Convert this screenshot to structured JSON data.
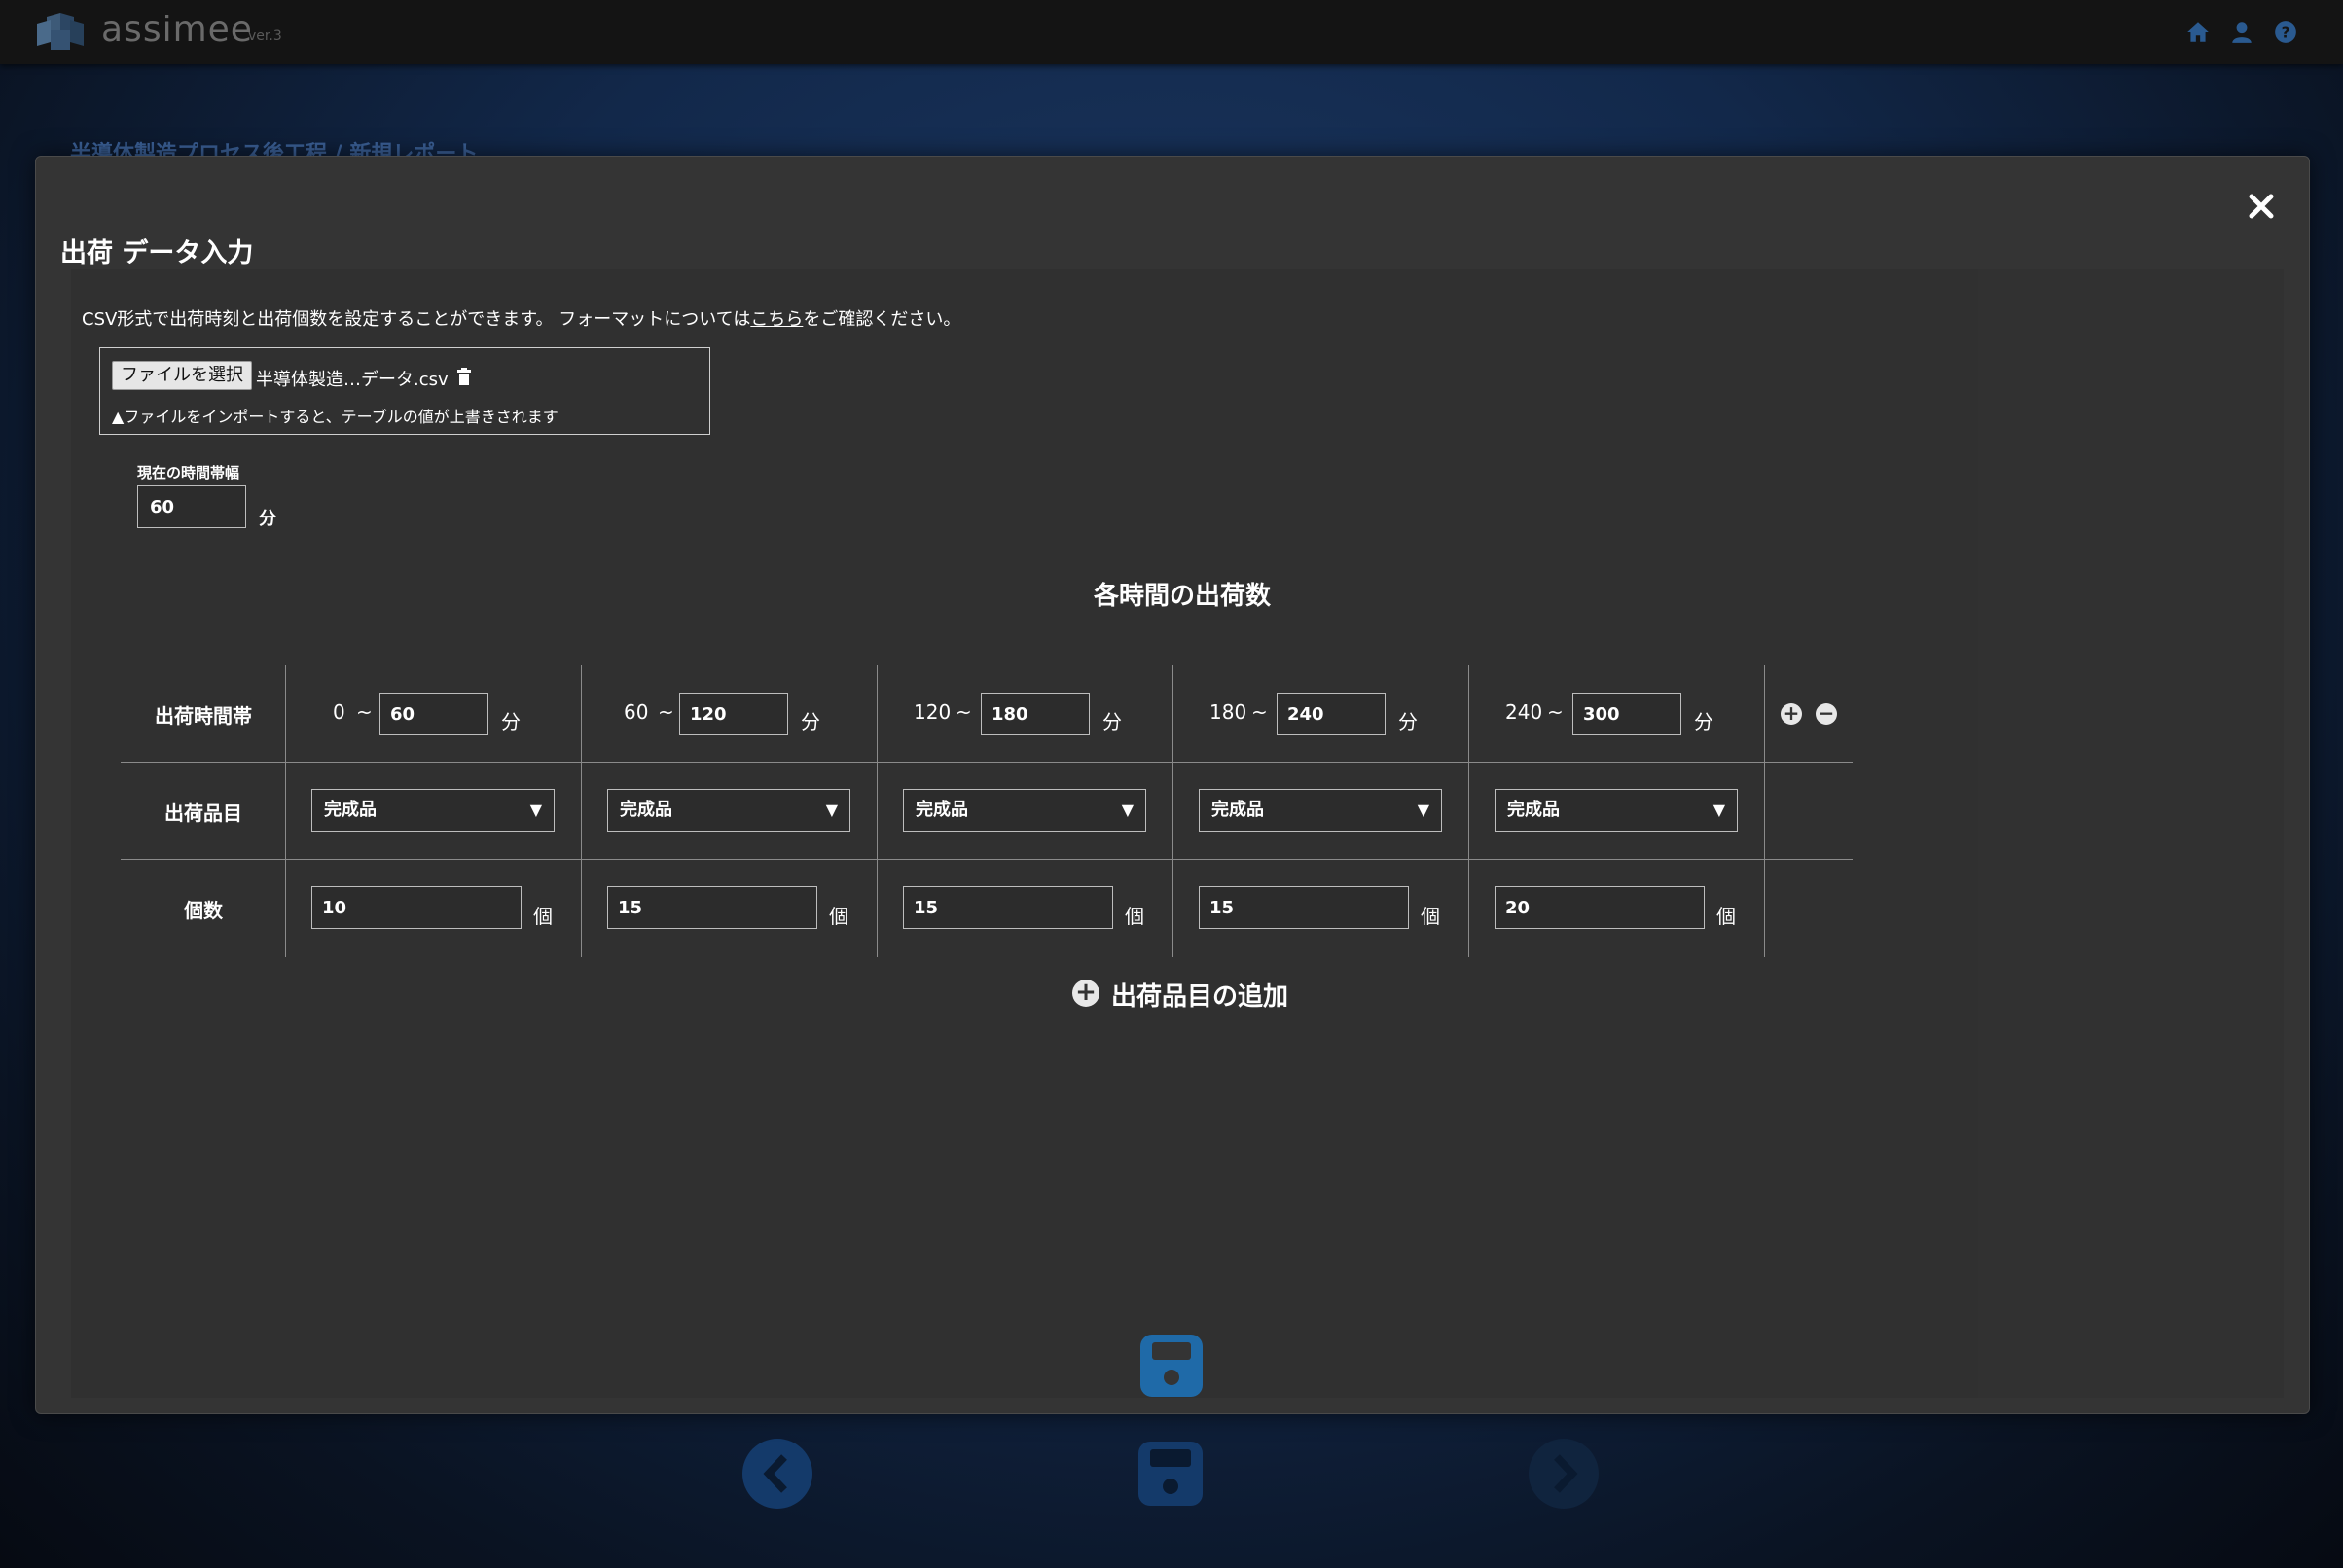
{
  "app": {
    "name": "assimee",
    "version": "ver.3"
  },
  "background": {
    "breadcrumb": "半導体製造プロセス後工程 / 新規レポート"
  },
  "modal": {
    "title": "出荷 データ入力",
    "description_prefix": "CSV形式で出荷時刻と出荷個数を設定することができます。 フォーマットについては",
    "description_link": "こちら",
    "description_suffix": "をご確認ください。",
    "file": {
      "button_label": "ファイルを選択",
      "file_name": "半導体製造…データ.csv",
      "warning": "ファイルをインポートすると、テーブルの値が上書きされます"
    },
    "time_width": {
      "label": "現在の時間帯幅",
      "value": "60",
      "unit": "分"
    },
    "section_title": "各時間の出荷数",
    "table": {
      "row_labels": {
        "time_band": "出荷時間帯",
        "item": "出荷品目",
        "count": "個数"
      },
      "tilde": "~",
      "minute_unit": "分",
      "count_unit": "個",
      "columns": [
        {
          "start": "0",
          "end": "60",
          "item": "完成品",
          "count": "10"
        },
        {
          "start": "60",
          "end": "120",
          "item": "完成品",
          "count": "15"
        },
        {
          "start": "120",
          "end": "180",
          "item": "完成品",
          "count": "15"
        },
        {
          "start": "180",
          "end": "240",
          "item": "完成品",
          "count": "15"
        },
        {
          "start": "240",
          "end": "300",
          "item": "完成品",
          "count": "20"
        }
      ]
    },
    "add_item_label": "出荷品目の追加"
  },
  "colors": {
    "accent": "#1f77b4",
    "modal_bg": "#343434",
    "topbar": "#141414"
  }
}
